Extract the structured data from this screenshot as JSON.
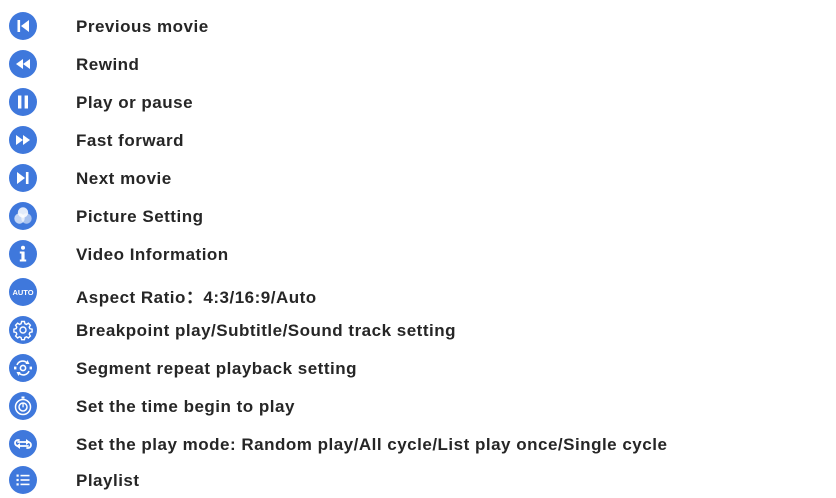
{
  "colors": {
    "icon_blue": "#3f78dc",
    "text": "#262626"
  },
  "items": [
    {
      "icon": "previous-icon",
      "label": "Previous movie"
    },
    {
      "icon": "rewind-icon",
      "label": "Rewind"
    },
    {
      "icon": "play-pause-icon",
      "label": "Play or pause"
    },
    {
      "icon": "fast-forward-icon",
      "label": "Fast forward"
    },
    {
      "icon": "next-icon",
      "label": "Next movie"
    },
    {
      "icon": "picture-setting-icon",
      "label": "Picture Setting"
    },
    {
      "icon": "info-icon",
      "label": "Video Information"
    },
    {
      "icon": "aspect-auto-icon",
      "label": "Aspect Ratio：4:3/16:9/Auto",
      "icon_text": "AUTO"
    },
    {
      "icon": "gear-icon",
      "label": "Breakpoint play/Subtitle/Sound track setting"
    },
    {
      "icon": "segment-repeat-icon",
      "label": "Segment repeat playback setting"
    },
    {
      "icon": "timer-icon",
      "label": "Set the time begin to play"
    },
    {
      "icon": "play-mode-icon",
      "label": "Set the play mode: Random play/All cycle/List play once/Single cycle"
    },
    {
      "icon": "playlist-icon",
      "label": "Playlist"
    }
  ]
}
